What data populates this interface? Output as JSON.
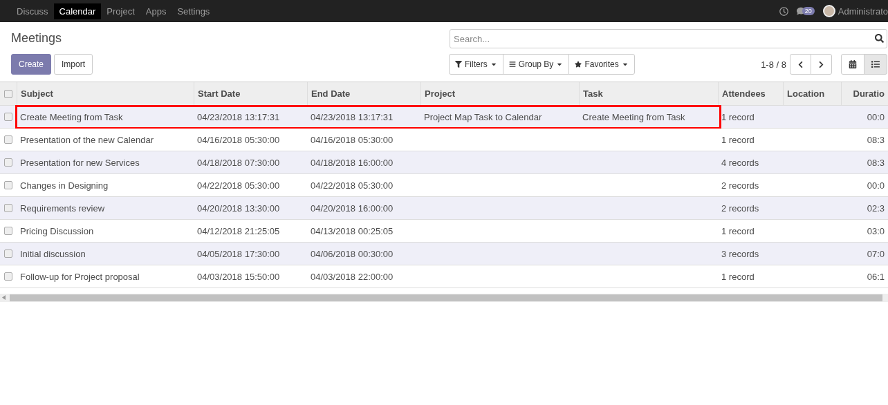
{
  "topbar": {
    "menu": [
      {
        "label": "Discuss",
        "selected": false
      },
      {
        "label": "Calendar",
        "selected": true
      },
      {
        "label": "Project",
        "selected": false
      },
      {
        "label": "Apps",
        "selected": false
      },
      {
        "label": "Settings",
        "selected": false
      }
    ],
    "message_count": "20",
    "user": "Administrato"
  },
  "title": "Meetings",
  "buttons": [
    {
      "label": "Create",
      "kind": "primary"
    },
    {
      "label": "Import",
      "kind": "secondary"
    }
  ],
  "search": {
    "placeholder": "Search..."
  },
  "search_options": [
    {
      "label": "Filters",
      "kind": "filter"
    },
    {
      "label": "Group By",
      "kind": "group"
    },
    {
      "label": "Favorites",
      "kind": "star"
    }
  ],
  "pager": "1-8 / 8",
  "views": [
    {
      "kind": "calendar",
      "selected": false
    },
    {
      "kind": "list",
      "selected": true
    }
  ],
  "table": {
    "select_all_checked": false,
    "columns": [
      "Subject",
      "Start Date",
      "End Date",
      "Project",
      "Task",
      "Attendees",
      "Location",
      "Duratio"
    ],
    "rows": [
      {
        "checked": false,
        "highlighted": true,
        "cells": [
          "Create Meeting from Task",
          "04/23/2018 13:17:31",
          "04/23/2018 13:17:31",
          "Project Map Task to Calendar",
          "Create Meeting from Task",
          "1 record",
          "",
          "00:0"
        ]
      },
      {
        "checked": false,
        "highlighted": false,
        "cells": [
          "Presentation of the new Calendar",
          "04/16/2018 05:30:00",
          "04/16/2018 05:30:00",
          "",
          "",
          "1 record",
          "",
          "08:3"
        ]
      },
      {
        "checked": false,
        "highlighted": false,
        "cells": [
          "Presentation for new Services",
          "04/18/2018 07:30:00",
          "04/18/2018 16:00:00",
          "",
          "",
          "4 records",
          "",
          "08:3"
        ]
      },
      {
        "checked": false,
        "highlighted": false,
        "cells": [
          "Changes in Designing",
          "04/22/2018 05:30:00",
          "04/22/2018 05:30:00",
          "",
          "",
          "2 records",
          "",
          "00:0"
        ]
      },
      {
        "checked": false,
        "highlighted": false,
        "cells": [
          "Requirements review",
          "04/20/2018 13:30:00",
          "04/20/2018 16:00:00",
          "",
          "",
          "2 records",
          "",
          "02:3"
        ]
      },
      {
        "checked": false,
        "highlighted": false,
        "cells": [
          "Pricing Discussion",
          "04/12/2018 21:25:05",
          "04/13/2018 00:25:05",
          "",
          "",
          "1 record",
          "",
          "03:0"
        ]
      },
      {
        "checked": false,
        "highlighted": false,
        "cells": [
          "Initial discussion",
          "04/05/2018 17:30:00",
          "04/06/2018 00:30:00",
          "",
          "",
          "3 records",
          "",
          "07:0"
        ]
      },
      {
        "checked": false,
        "highlighted": false,
        "cells": [
          "Follow-up for Project proposal",
          "04/03/2018 15:50:00",
          "04/03/2018 22:00:00",
          "",
          "",
          "1 record",
          "",
          "06:1"
        ]
      }
    ]
  }
}
